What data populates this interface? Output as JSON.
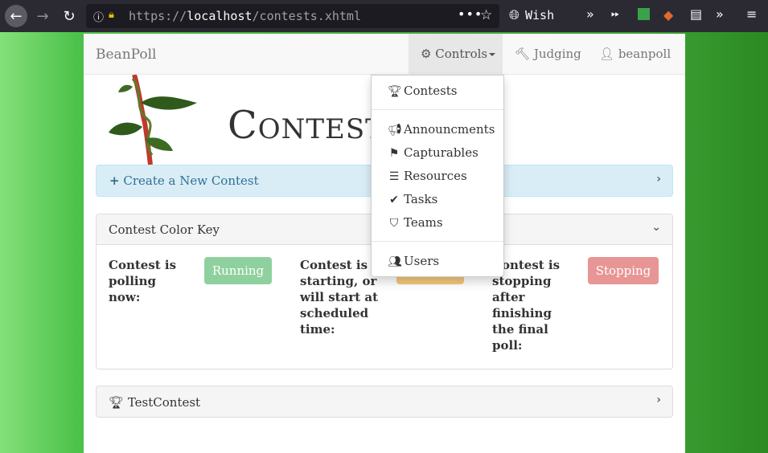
{
  "browser": {
    "url_scheme": "https://",
    "url_host": "localhost",
    "url_path": "/contests.xhtml",
    "wish_label": "Wish"
  },
  "navbar": {
    "brand": "BeanPoll",
    "controls_label": "Controls",
    "judging_label": "Judging",
    "user_label": "beanpoll"
  },
  "page": {
    "title": "Contests"
  },
  "create_panel": {
    "label": "Create a New Contest"
  },
  "color_key": {
    "title": "Contest Color Key",
    "polling_text": "Contest is polling now:",
    "polling_badge": "Running",
    "starting_text": "Contest is starting, or will start at scheduled time:",
    "starting_badge": "Starting",
    "stopping_text": "Contest is stopping after finishing the final poll:",
    "stopping_badge": "Stopping",
    "colors": {
      "running": "#8fd19e",
      "starting": "#f5c97b",
      "stopping": "#e89595"
    }
  },
  "contest_panel": {
    "label": "TestContest"
  },
  "dropdown": {
    "items": [
      {
        "label": "Contests",
        "icon": "trophy-icon"
      },
      {
        "label": "Announcments",
        "icon": "bullhorn-icon"
      },
      {
        "label": "Capturables",
        "icon": "flag-icon"
      },
      {
        "label": "Resources",
        "icon": "server-icon"
      },
      {
        "label": "Tasks",
        "icon": "check-icon"
      },
      {
        "label": "Teams",
        "icon": "shield-icon"
      },
      {
        "label": "Users",
        "icon": "users-icon"
      }
    ]
  }
}
